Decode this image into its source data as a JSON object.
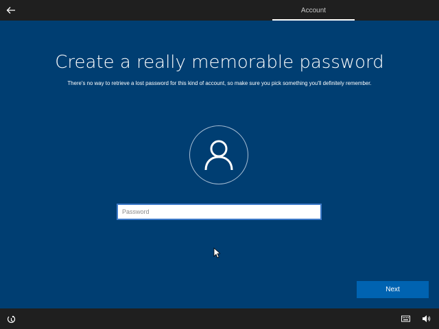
{
  "header": {
    "back_icon": "back-arrow-icon",
    "active_tab": "Account"
  },
  "main": {
    "title": "Create a really memorable password",
    "subtitle": "There's no way to retrieve a lost password for this kind of account, so make sure you pick something you'll definitely remember.",
    "avatar_icon": "user-icon",
    "password_field": {
      "placeholder": "Password",
      "value": ""
    },
    "next_label": "Next"
  },
  "footer": {
    "ease_of_access_icon": "ease-of-access-icon",
    "keyboard_icon": "keyboard-icon",
    "volume_icon": "volume-icon"
  },
  "colors": {
    "background": "#003e72",
    "bars": "#1f1f1f",
    "accent": "#0063b1"
  }
}
